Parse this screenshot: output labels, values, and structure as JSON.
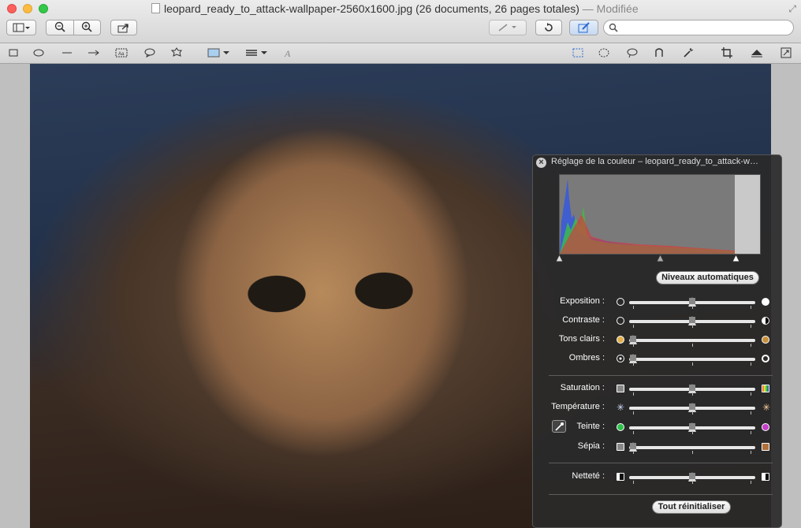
{
  "window": {
    "title": "leopard_ready_to_attack-wallpaper-2560x1600.jpg (26 documents, 26 pages totales)",
    "modified": "— Modifiée"
  },
  "toolbar": {
    "search": {
      "placeholder": "",
      "value": ""
    }
  },
  "panel": {
    "title": "Réglage de la couleur – leopard_ready_to_attack-w…",
    "auto_levels": "Niveaux automatiques",
    "reset_all": "Tout réinitialiser",
    "sliders": [
      {
        "label": "Exposition :",
        "value": 0.5
      },
      {
        "label": "Contraste :",
        "value": 0.5
      },
      {
        "label": "Tons clairs :",
        "value": 0.0
      },
      {
        "label": "Ombres :",
        "value": 0.0
      },
      {
        "label": "Saturation :",
        "value": 0.5
      },
      {
        "label": "Température :",
        "value": 0.5
      },
      {
        "label": "Teinte :",
        "value": 0.5
      },
      {
        "label": "Sépia :",
        "value": 0.0
      },
      {
        "label": "Netteté :",
        "value": 0.5
      }
    ],
    "histogram_levels": {
      "black": 0.0,
      "mid": 0.5,
      "white": 0.875
    }
  },
  "colors": {
    "histogram_blue": "#3a5bd8",
    "histogram_red": "#d83a3a",
    "histogram_green": "#3ac83a"
  }
}
